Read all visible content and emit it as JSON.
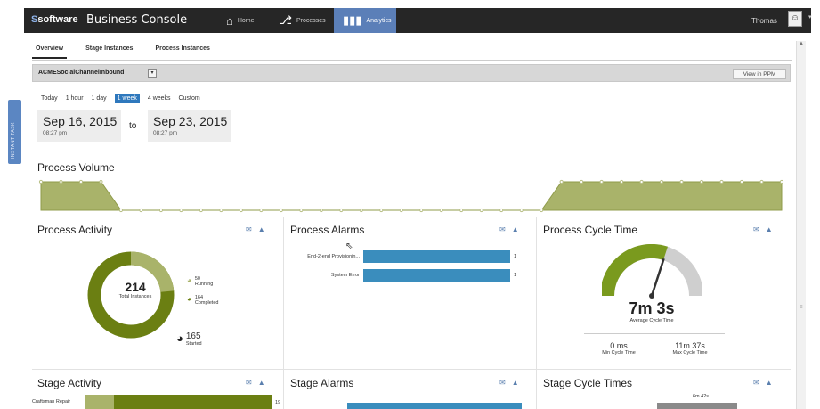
{
  "sidebar": {
    "instant_tab_label": "INSTANT TASK"
  },
  "topbar": {
    "logo_mark": "S",
    "logo_text": "software",
    "console_title": "Business Console",
    "nav": [
      {
        "label": "Home",
        "icon": "home-icon"
      },
      {
        "label": "Processes",
        "icon": "processes-icon"
      },
      {
        "label": "Analytics",
        "icon": "analytics-icon"
      }
    ],
    "username": "Thomas"
  },
  "tabs": [
    {
      "label": "Overview",
      "active": true
    },
    {
      "label": "Stage Instances",
      "active": false
    },
    {
      "label": "Process Instances",
      "active": false
    }
  ],
  "filter": {
    "process_name": "ACMESocialChannelInbound",
    "view_button": "View in PPM"
  },
  "time_ranges": {
    "options": [
      "Today",
      "1 hour",
      "1 day",
      "1 week",
      "4 weeks",
      "Custom"
    ],
    "selected": "1 week"
  },
  "date_range": {
    "from_date": "Sep 16, 2015",
    "from_time": "08:27 pm",
    "connector": "to",
    "to_date": "Sep 23, 2015",
    "to_time": "08:27 pm"
  },
  "process_volume": {
    "title": "Process Volume",
    "values": [
      1,
      1,
      1,
      1,
      0,
      0,
      0,
      0,
      0,
      0,
      0,
      0,
      0,
      0,
      0,
      0,
      0,
      0,
      0,
      0,
      0,
      0,
      0,
      0,
      0,
      0,
      1,
      1,
      1,
      1,
      1,
      1,
      1,
      1,
      1,
      1,
      1,
      1
    ]
  },
  "process_activity": {
    "title": "Process Activity",
    "total": "214",
    "total_label": "Total Instances",
    "running_value": "50",
    "running_label": "Running",
    "completed_value": "164",
    "completed_label": "Completed",
    "started_value": "165",
    "started_label": "Started",
    "running_fraction": 0.234
  },
  "process_alarms": {
    "title": "Process Alarms",
    "bars": [
      {
        "label": "End-2-end Provisionin...",
        "value": "1"
      },
      {
        "label": "System Error",
        "value": "1"
      }
    ]
  },
  "process_cycle_time": {
    "title": "Process Cycle Time",
    "average": "7m 3s",
    "average_label": "Average Cycle Time",
    "min_value": "0 ms",
    "min_label": "Min Cycle Time",
    "max_value": "11m 37s",
    "max_label": "Max Cycle Time",
    "gauge_fraction": 0.6
  },
  "stage_activity": {
    "title": "Stage Activity",
    "first_label": "Craftsman Repair",
    "first_value": "19"
  },
  "stage_alarms": {
    "title": "Stage Alarms"
  },
  "stage_cycle_times": {
    "title": "Stage Cycle Times",
    "top_value": "6m 42s"
  },
  "colors": {
    "olive": "#6b7f12",
    "olive_light": "#a9b36a",
    "alarm_blue": "#3a8dbd",
    "nav_active": "#5b7fb8",
    "range_active": "#2e78bd",
    "gauge_green": "#7a9a1e",
    "gauge_gray": "#cfcfcf"
  }
}
